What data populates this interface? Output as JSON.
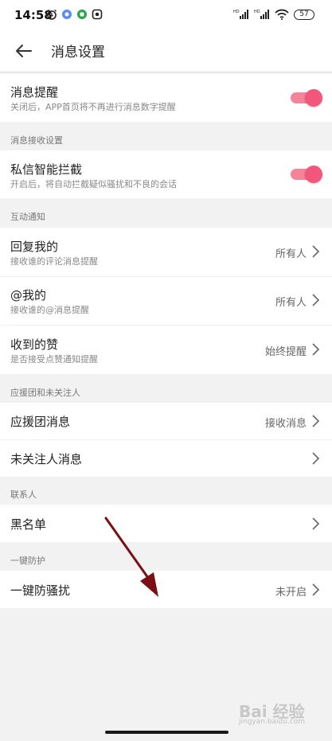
{
  "status_bar": {
    "time": "14:58",
    "battery": "57"
  },
  "header": {
    "title": "消息设置"
  },
  "message_reminder": {
    "title": "消息提醒",
    "subtitle": "关闭后，APP首页将不再进行消息数字提醒",
    "enabled": true
  },
  "receive_settings": {
    "section_label": "消息接收设置",
    "dm_filter": {
      "title": "私信智能拦截",
      "subtitle": "开启后，将自动拦截疑似骚扰和不良的会话",
      "enabled": true
    }
  },
  "interaction": {
    "section_label": "互动通知",
    "items": [
      {
        "title": "回复我的",
        "subtitle": "接收谁的评论消息提醒",
        "value": "所有人"
      },
      {
        "title": "@我的",
        "subtitle": "接收谁的@消息提醒",
        "value": "所有人"
      },
      {
        "title": "收到的赞",
        "subtitle": "是否接受点赞通知提醒",
        "value": "始终提醒"
      }
    ]
  },
  "fanclub": {
    "section_label": "应援团和未关注人",
    "items": [
      {
        "title": "应援团消息",
        "value": "接收消息"
      },
      {
        "title": "未关注人消息",
        "value": ""
      }
    ]
  },
  "contacts": {
    "section_label": "联系人",
    "blacklist": {
      "title": "黑名单"
    }
  },
  "protection": {
    "section_label": "一键防护",
    "anti_harass": {
      "title": "一键防骚扰",
      "value": "未开启"
    }
  },
  "watermark": {
    "brand": "Bai 经验",
    "url": "jingyan.baidu.com"
  },
  "colors": {
    "toggle_on": "#f2577b",
    "annotation_arrow": "#7a0f14"
  }
}
